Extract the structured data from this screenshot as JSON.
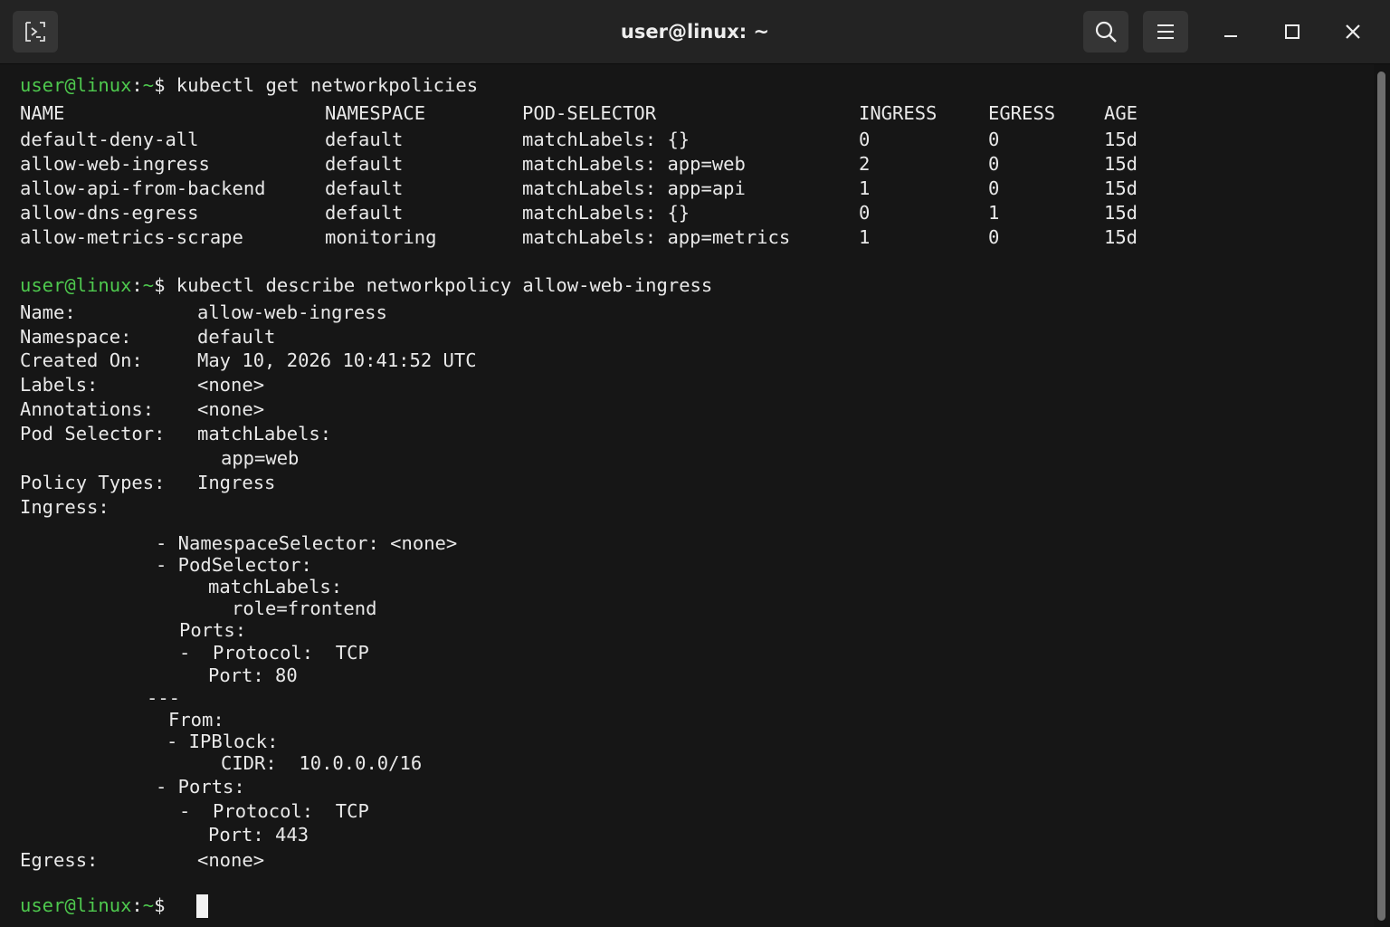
{
  "window": {
    "title": "user@linux: ~",
    "icons": [
      "new-tab-icon",
      "search-icon",
      "hamburger-menu-icon",
      "minimize-icon",
      "maximize-icon",
      "close-icon"
    ]
  },
  "prompt": {
    "user": "user@linux",
    "sep": ":",
    "path": "~",
    "symbol": "$"
  },
  "commands": {
    "get": "kubectl get networkpolicies",
    "describe": "kubectl describe networkpolicy allow-web-ingress"
  },
  "table": {
    "headers": [
      "NAME",
      "NAMESPACE",
      "POD-SELECTOR",
      "INGRESS",
      "EGRESS",
      "AGE"
    ],
    "rows": [
      [
        "default-deny-all",
        "default",
        "matchLabels: {}",
        "0",
        "0",
        "15d"
      ],
      [
        "allow-web-ingress",
        "default",
        "matchLabels: app=web",
        "2",
        "0",
        "15d"
      ],
      [
        "allow-api-from-backend",
        "default",
        "matchLabels: app=api",
        "1",
        "0",
        "15d"
      ],
      [
        "allow-dns-egress",
        "default",
        "matchLabels: {}",
        "0",
        "1",
        "15d"
      ],
      [
        "allow-metrics-scrape",
        "monitoring",
        "matchLabels: app=metrics",
        "1",
        "0",
        "15d"
      ]
    ]
  },
  "describe": {
    "fields": [
      {
        "label": "Name:",
        "value": "allow-web-ingress"
      },
      {
        "label": "Namespace:",
        "value": "default"
      },
      {
        "label": "Created On:",
        "value": "May 10, 2026 10:41:52 UTC"
      },
      {
        "label": "Labels:",
        "value": "<none>"
      },
      {
        "label": "Annotations:",
        "value": "<none>"
      },
      {
        "label": "Pod Selector:",
        "value": "matchLabels:"
      }
    ],
    "pod_selector_label": "app=web",
    "policy_types_label": "Policy Types:",
    "policy_types_value": "Ingress",
    "ingress_label": "Ingress:",
    "ingress_lines": [
      "- NamespaceSelector: <none>",
      "- PodSelector:",
      "matchLabels:",
      "role=frontend",
      "Ports:",
      "-  Protocol:  TCP",
      "Port: 80",
      "---",
      "From:",
      "- IPBlock:",
      "CIDR:  10.0.0.0/16",
      "- Ports:",
      "-  Protocol:  TCP",
      "Port: 443"
    ],
    "egress_label": "Egress:",
    "egress_value": "<none>"
  }
}
